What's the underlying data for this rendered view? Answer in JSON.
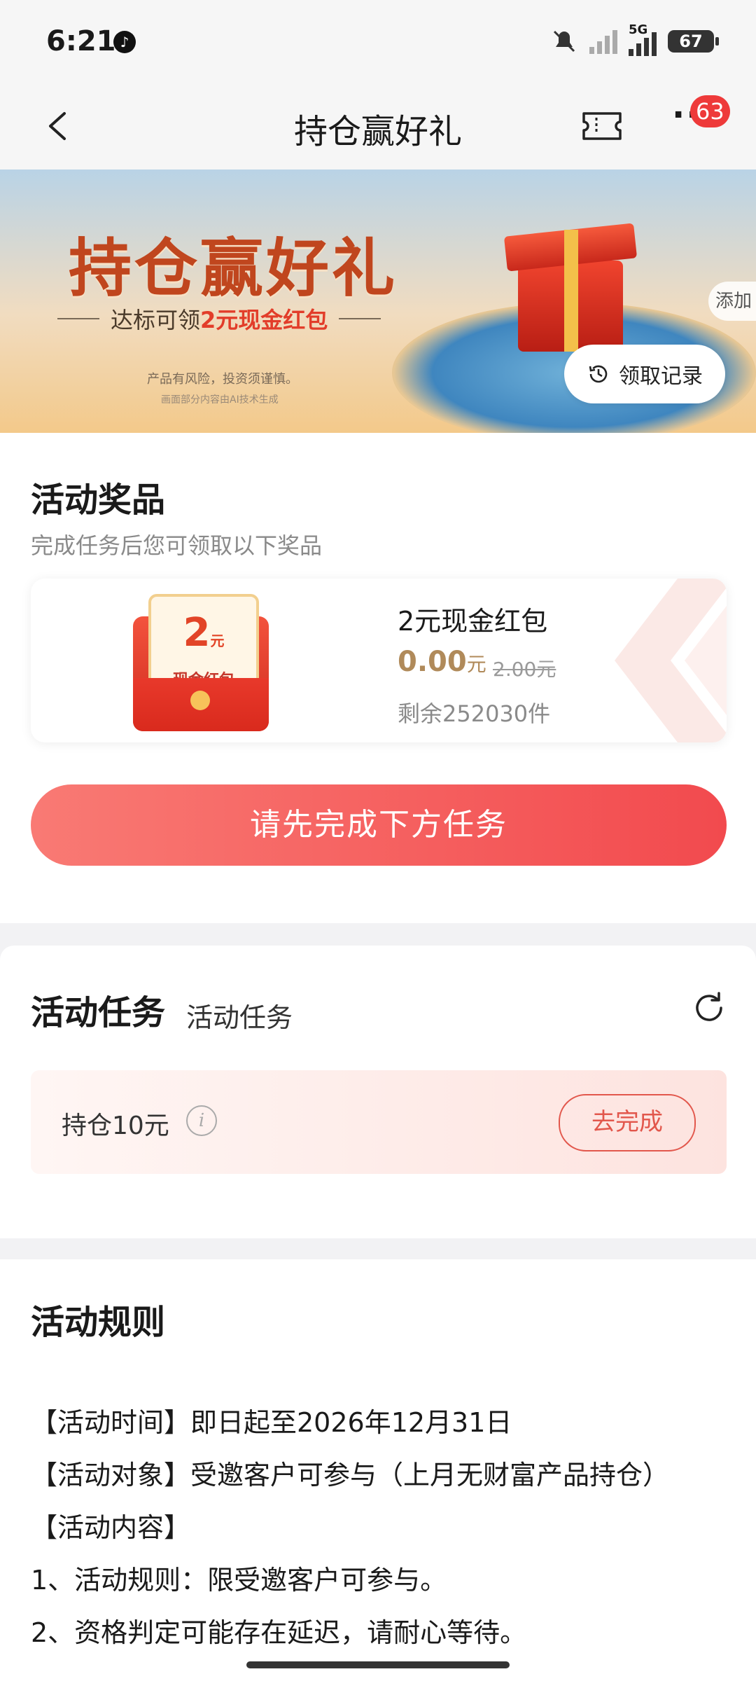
{
  "status_bar": {
    "time": "6:21",
    "network": "5G",
    "battery": "67"
  },
  "nav": {
    "title": "持仓赢好礼",
    "badge": "63"
  },
  "banner": {
    "title": "持仓赢好礼",
    "subtitle_prefix": "达标可领",
    "subtitle_highlight": "2元现金红包",
    "risk_note": "产品有风险，投资须谨慎。",
    "ai_note": "画面部分内容由AI技术生成",
    "add_label": "添加",
    "record_button": "领取记录"
  },
  "prizes_section": {
    "title": "活动奖品",
    "subtitle": "完成任务后您可领取以下奖品",
    "prize": {
      "badge_number": "2",
      "badge_unit": "元",
      "badge_text": "现金红包",
      "name": "2元现金红包",
      "price": "0.00",
      "price_unit": "元",
      "original_price": "2.00元",
      "remaining": "剩余252030件"
    },
    "cta_label": "请先完成下方任务"
  },
  "tasks_section": {
    "title": "活动任务",
    "subtitle": "活动任务",
    "task": {
      "name": "持仓10元",
      "button": "去完成"
    }
  },
  "rules_section": {
    "title": "活动规则",
    "lines": [
      "【活动时间】即日起至2026年12月31日",
      "【活动对象】受邀客户可参与（上月无财富产品持仓）",
      "【活动内容】",
      "1、活动规则：限受邀客户可参与。",
      "2、资格判定可能存在延迟，请耐心等待。"
    ]
  },
  "colors": {
    "accent": "#f24a4e",
    "gold_price": "#b08a5a",
    "task_button": "#e2574c"
  }
}
